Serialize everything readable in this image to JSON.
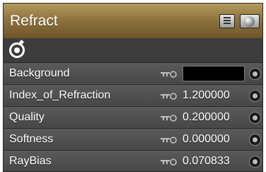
{
  "panel": {
    "title": "Refract",
    "icons": {
      "list": "list-icon",
      "preview": "sphere-preview-icon",
      "tool": "target-rotate-icon"
    }
  },
  "properties": [
    {
      "name": "Background",
      "kind": "color",
      "value": "",
      "color": "#000000"
    },
    {
      "name": "Index_of_Refraction",
      "kind": "number",
      "value": "1.200000"
    },
    {
      "name": "Quality",
      "kind": "number",
      "value": "0.200000"
    },
    {
      "name": "Softness",
      "kind": "number",
      "value": "0.000000"
    },
    {
      "name": "RayBias",
      "kind": "number",
      "value": "0.070833"
    }
  ],
  "colors": {
    "title_bar": "#8f7440",
    "row_bg": "#4f4f4f",
    "text": "#ffffff"
  }
}
